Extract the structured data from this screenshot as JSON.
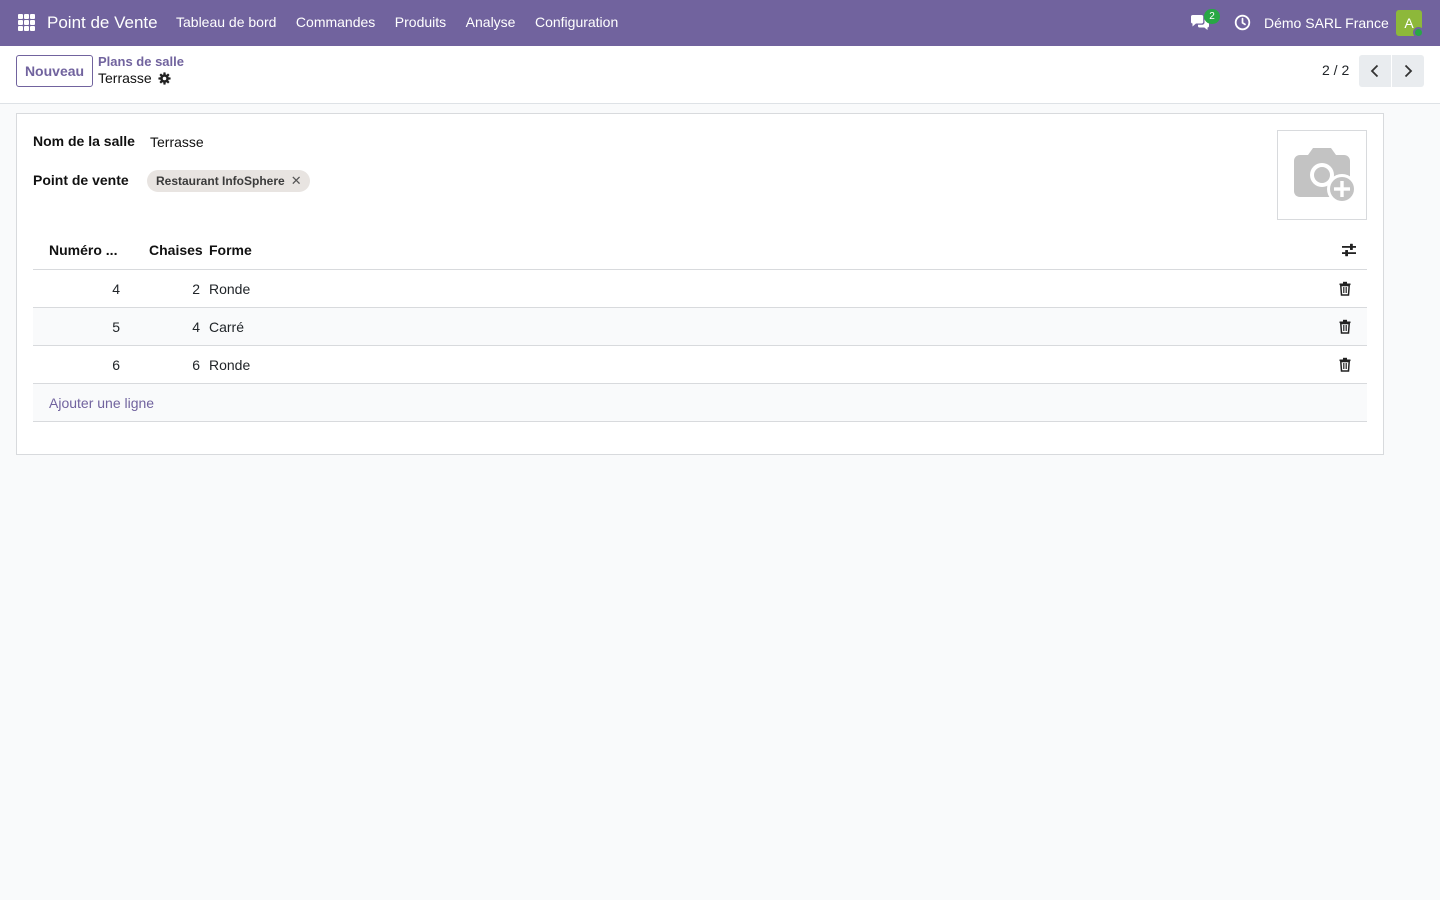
{
  "navbar": {
    "app_name": "Point de Vente",
    "menu": [
      "Tableau de bord",
      "Commandes",
      "Produits",
      "Analyse",
      "Configuration"
    ],
    "messages_badge": "2",
    "company": "Démo SARL France",
    "avatar_letter": "A",
    "color": "#71639e"
  },
  "control": {
    "new_button": "Nouveau",
    "breadcrumb": "Plans de salle",
    "record_title": "Terrasse",
    "pager": "2 / 2"
  },
  "form": {
    "name_label": "Nom de la salle",
    "name_value": "Terrasse",
    "pos_label": "Point de vente",
    "pos_tag": "Restaurant InfoSphere",
    "image_icon": "camera-add-icon"
  },
  "table": {
    "headers": {
      "number": "Numéro ...",
      "chairs": "Chaises",
      "shape": "Forme"
    },
    "rows": [
      {
        "number": "4",
        "chairs": "2",
        "shape": "Ronde"
      },
      {
        "number": "5",
        "chairs": "4",
        "shape": "Carré"
      },
      {
        "number": "6",
        "chairs": "6",
        "shape": "Ronde"
      }
    ],
    "add_line": "Ajouter une ligne"
  }
}
